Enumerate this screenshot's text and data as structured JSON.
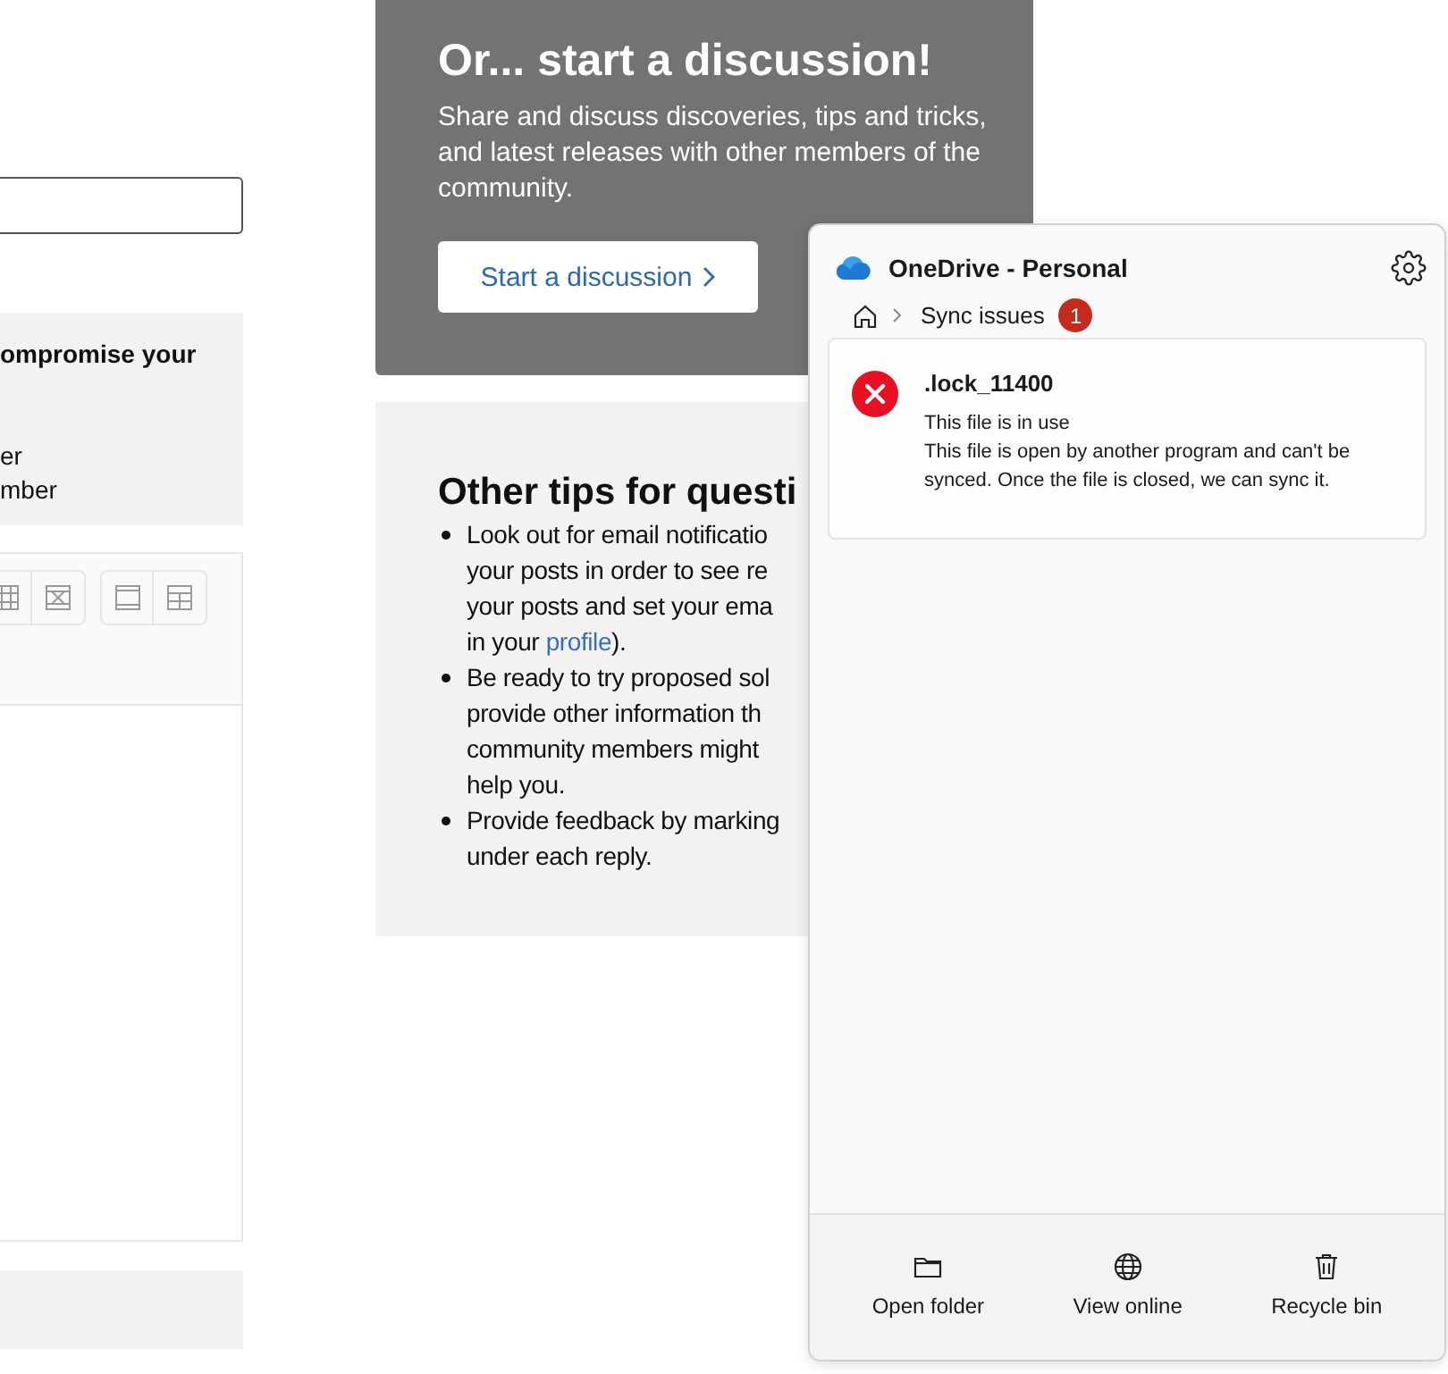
{
  "notice": {
    "lines": [
      {
        "kind": "heading",
        "text": "ompromise your"
      },
      {
        "kind": "body",
        "text": "er"
      },
      {
        "kind": "body",
        "text": "mber"
      }
    ]
  },
  "discussion_card": {
    "title": "Or... start a discussion!",
    "text": "Share and discuss discoveries, tips and tricks, and latest releases with other members of the community.",
    "button": "Start a discussion"
  },
  "tips_card": {
    "title": "Other tips for questi",
    "bullets": [
      {
        "lines": [
          [
            {
              "text": "Look out for email notificatio"
            }
          ],
          [
            {
              "text": "your posts in order to see re"
            }
          ],
          [
            {
              "text": "your posts and set your ema"
            }
          ],
          [
            {
              "text": "in your "
            },
            {
              "text": "profile",
              "link": true
            },
            {
              "text": ")."
            }
          ]
        ]
      },
      {
        "lines": [
          [
            {
              "text": "Be ready to try proposed sol"
            }
          ],
          [
            {
              "text": "provide other information th"
            }
          ],
          [
            {
              "text": "community members might"
            }
          ],
          [
            {
              "text": "help you."
            }
          ]
        ]
      },
      {
        "lines": [
          [
            {
              "text": "Provide feedback by marking"
            }
          ],
          [
            {
              "text": "under each reply."
            }
          ]
        ]
      }
    ]
  },
  "flyout": {
    "title": "OneDrive - Personal",
    "breadcrumb": {
      "label": "Sync issues",
      "count": "1"
    },
    "issues": [
      {
        "name": ".lock_11400",
        "status": "This file is in use",
        "description": "This file is open by another program and can't be synced. Once the file is closed, we can sync it."
      }
    ],
    "actions": [
      {
        "kind": "folder",
        "label": "Open folder"
      },
      {
        "kind": "globe",
        "label": "View online"
      },
      {
        "kind": "bin",
        "label": "Recycle bin"
      }
    ]
  }
}
